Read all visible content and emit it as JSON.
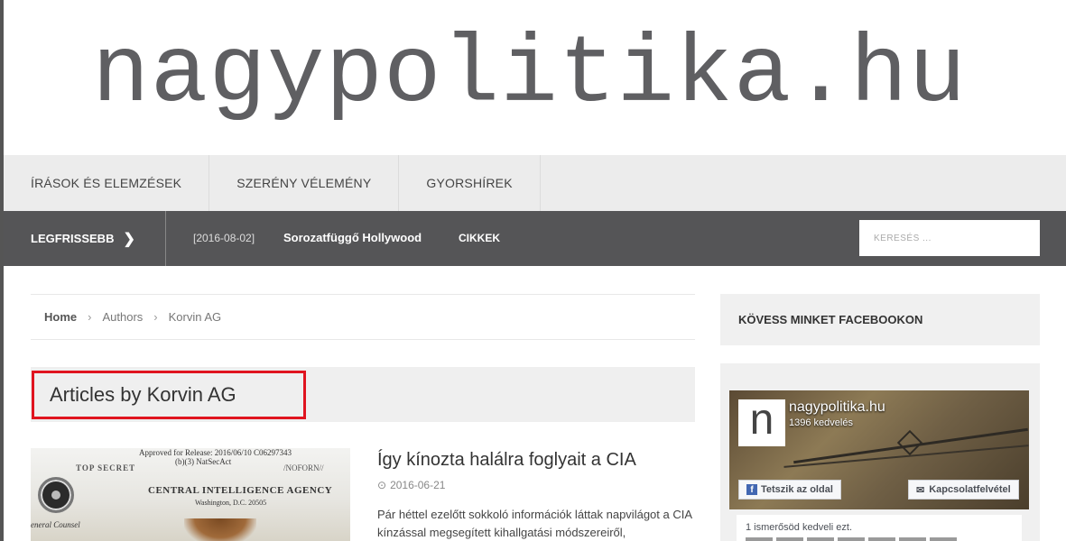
{
  "site": {
    "logo_text": "nagypolitika.hu"
  },
  "nav": {
    "items": [
      {
        "label": "ÍRÁSOK ÉS ELEMZÉSEK"
      },
      {
        "label": "SZERÉNY VÉLEMÉNY"
      },
      {
        "label": "GYORSHÍREK"
      }
    ]
  },
  "ticker": {
    "label": "LEGFRISSEBB",
    "date": "[2016-08-02]",
    "headline": "Sorozatfüggő Hollywood",
    "category": "CIKKEK",
    "search_placeholder": "KERESÉS ..."
  },
  "breadcrumb": {
    "home": "Home",
    "authors": "Authors",
    "current": "Korvin AG"
  },
  "archive": {
    "heading": "Articles by Korvin AG"
  },
  "article": {
    "title": "Így kínozta halálra foglyait a CIA",
    "date": "2016-06-21",
    "excerpt": "Pár héttel ezelőtt sokkoló információk láttak napvilágot a CIA kínzással megsegített kihallgatási módszereiről,",
    "thumb": {
      "line1": "Approved for Release: 2016/06/10 C06297343",
      "line2": "(b)(3) NatSecAct",
      "line3": "TOP SECRET",
      "line4": "/NOFORN//",
      "agency": "CENTRAL INTELLIGENCE AGENCY",
      "city": "Washington, D.C. 20505",
      "counsel": "eneral Counsel"
    }
  },
  "sidebar": {
    "title": "KÖVESS MINKET FACEBOOKON",
    "fb": {
      "logo_letter": "n",
      "page_name": "nagypolitika.hu",
      "likes": "1396 kedvelés",
      "like_button": "Tetszik az oldal",
      "message_button": "Kapcsolatfelvétel",
      "friends_text": "1 ismerősöd kedveli ezt."
    }
  }
}
